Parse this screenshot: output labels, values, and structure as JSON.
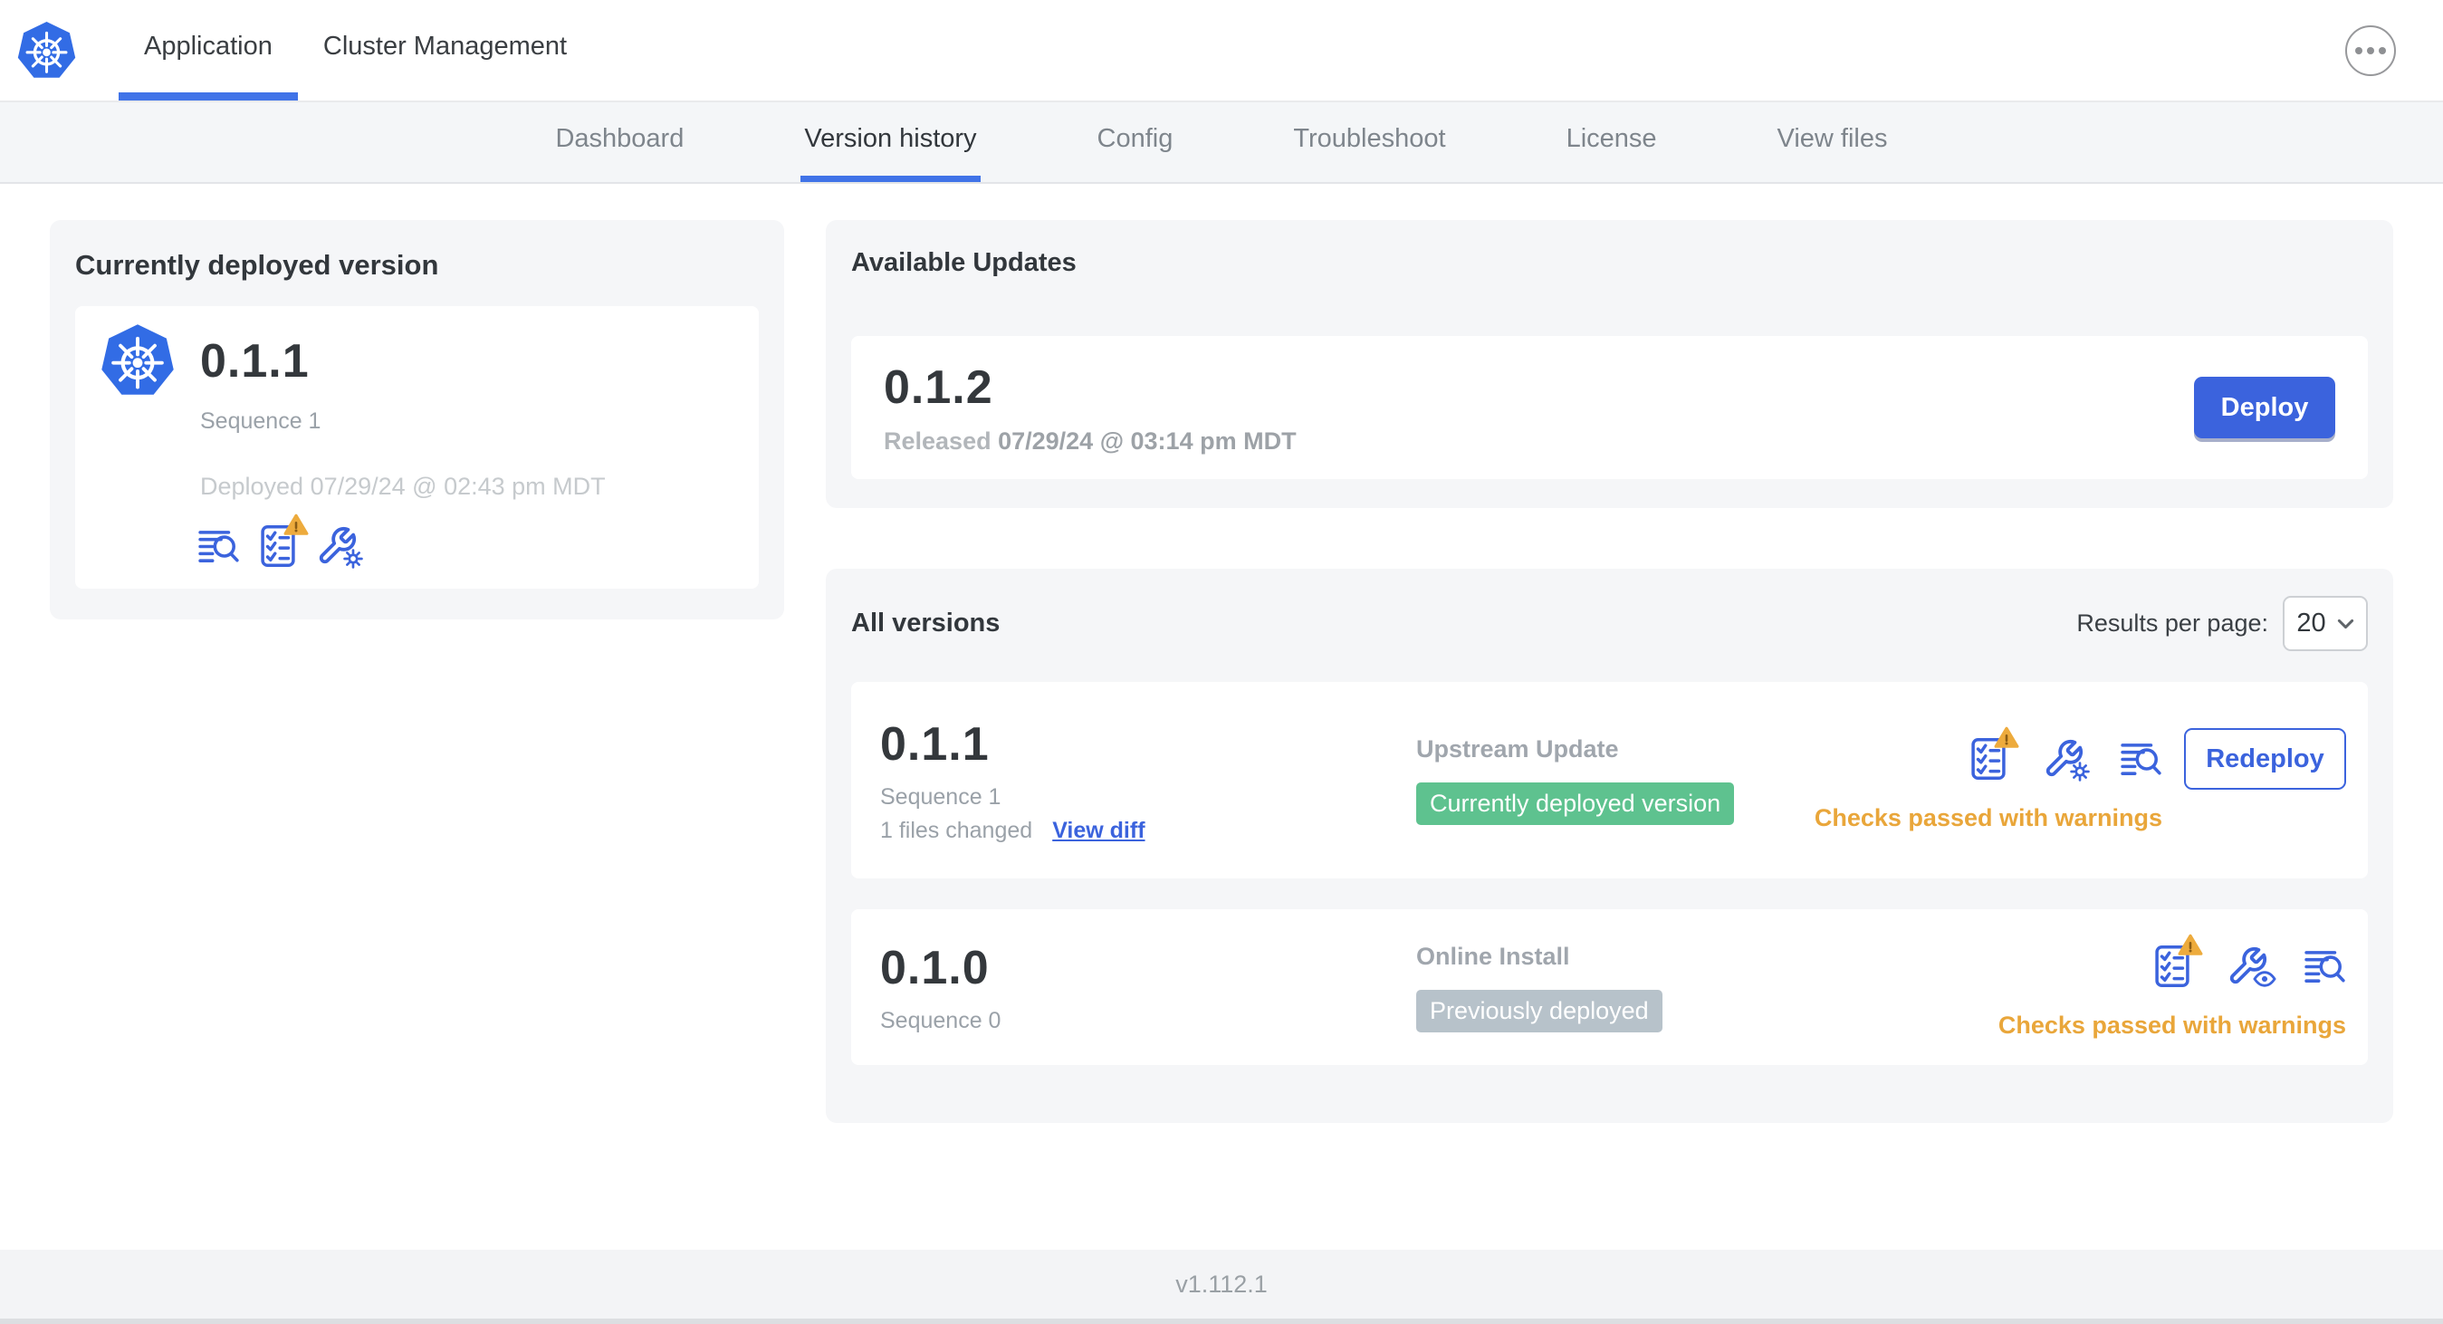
{
  "colors": {
    "k8s_blue": "#326ce5",
    "accent_blue": "#3b63dd",
    "success_green": "#5ec28f",
    "neutral_badge_gray": "#b7c2ca",
    "warning_orange": "#e9a63a"
  },
  "header": {
    "logo_icon": "kubernetes-logo",
    "tabs": [
      {
        "label": "Application",
        "active": true
      },
      {
        "label": "Cluster Management",
        "active": false
      }
    ],
    "more_icon": "ellipsis-icon"
  },
  "subnav": {
    "tabs": [
      "Dashboard",
      "Version history",
      "Config",
      "Troubleshoot",
      "License",
      "View files"
    ],
    "active_tab": "Version history"
  },
  "current_version": {
    "title": "Currently deployed version",
    "version": "0.1.1",
    "sequence": "Sequence 1",
    "deployed": "Deployed 07/29/24 @ 02:43 pm MDT",
    "icons": [
      "diff-logs-icon",
      "preflight-checklist-warning-icon",
      "wrench-gear-icon"
    ]
  },
  "available_updates": {
    "title": "Available Updates",
    "version": "0.1.2",
    "released_label": "Released",
    "released_date": "07/29/24 @ 03:14 pm MDT",
    "deploy_button": "Deploy"
  },
  "all_versions": {
    "title": "All versions",
    "results_per_page_label": "Results per page:",
    "results_per_page_value": "20",
    "rows": [
      {
        "version": "0.1.1",
        "sequence": "Sequence 1",
        "files_changed": "1 files changed",
        "view_diff_link": "View diff",
        "source": "Upstream Update",
        "status_badge": "Currently deployed version",
        "status_badge_color": "#5ec28f",
        "checks_status": "Checks passed with warnings",
        "action_button": "Redeploy",
        "icons": [
          "preflight-checklist-warning-icon",
          "wrench-gear-icon",
          "diff-logs-icon"
        ]
      },
      {
        "version": "0.1.0",
        "sequence": "Sequence 0",
        "source": "Online Install",
        "status_badge": "Previously deployed",
        "status_badge_color": "#b7c2ca",
        "checks_status": "Checks passed with warnings",
        "icons": [
          "preflight-checklist-warning-icon",
          "wrench-eye-icon",
          "diff-logs-icon"
        ]
      }
    ]
  },
  "footer": {
    "app_version": "v1.112.1"
  }
}
